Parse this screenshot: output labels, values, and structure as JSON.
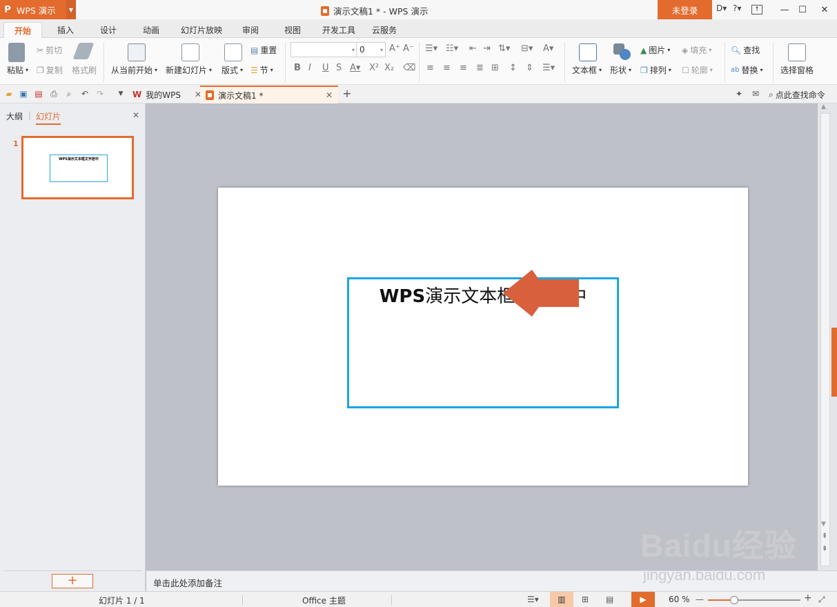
{
  "app": {
    "name": "WPS 演示",
    "logo": "P"
  },
  "window": {
    "title": "演示文稿1 * - WPS 演示",
    "login_label": "未登录"
  },
  "ribbon_tabs": [
    {
      "label": "开始",
      "active": true
    },
    {
      "label": "插入"
    },
    {
      "label": "设计"
    },
    {
      "label": "动画"
    },
    {
      "label": "幻灯片放映"
    },
    {
      "label": "审阅"
    },
    {
      "label": "视图"
    },
    {
      "label": "开发工具"
    },
    {
      "label": "云服务"
    }
  ],
  "ribbon": {
    "paste": "粘贴",
    "cut": "剪切",
    "copy": "复制",
    "format_painter": "格式刷",
    "from_current": "从当前开始",
    "new_slide": "新建幻灯片",
    "layout": "版式",
    "reset": "重置",
    "section": "节",
    "font_size": "0",
    "textbox": "文本框",
    "shape": "形状",
    "picture": "图片",
    "arrange": "排列",
    "fill": "填充",
    "outline": "轮廓",
    "find": "查找",
    "replace": "替换",
    "select_pane": "选择窗格"
  },
  "doc_tabs": [
    {
      "label": "我的WPS"
    },
    {
      "label": "演示文稿1 *",
      "active": true
    }
  ],
  "search_command": "点此查找命令",
  "left_pane": {
    "tab_outline": "大纲",
    "tab_slides": "幻灯片",
    "slide_number": "1",
    "thumb_text": "WPS演示文本框文字居中"
  },
  "slide": {
    "text_latin": "WPS",
    "text_cjk": "演示文本框文字居中"
  },
  "notes_placeholder": "单击此处添加备注",
  "status": {
    "slide_info": "幻灯片 1 / 1",
    "theme": "Office 主题",
    "zoom": "60 %"
  },
  "watermark": {
    "brand": "Baidu经验",
    "url": "jingyan.baidu.com"
  },
  "colors": {
    "accent": "#e36b2e",
    "textbox_border": "#1aa6e0",
    "arrow": "#d9603d"
  }
}
